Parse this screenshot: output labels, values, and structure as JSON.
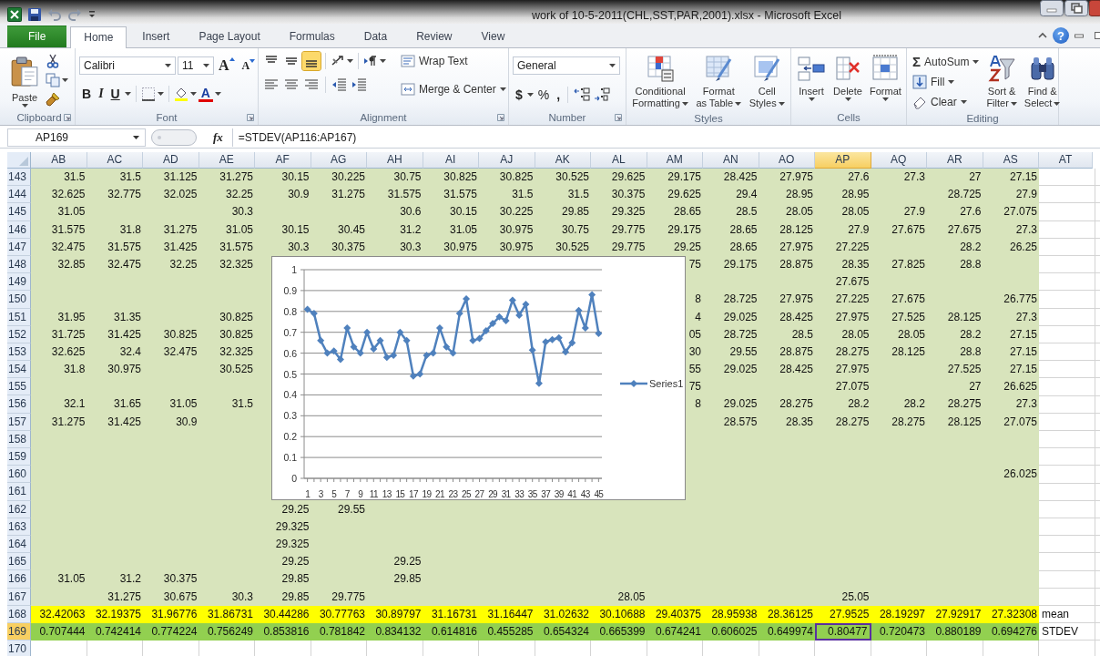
{
  "window": {
    "title": "work of 10-5-2011(CHL,SST,PAR,2001).xlsx  -  Microsoft Excel"
  },
  "tabs": [
    {
      "label": "File",
      "kind": "file",
      "selected": false
    },
    {
      "label": "Home",
      "kind": "tab",
      "selected": true
    },
    {
      "label": "Insert",
      "kind": "tab",
      "selected": false
    },
    {
      "label": "Page Layout",
      "kind": "tab",
      "selected": false
    },
    {
      "label": "Formulas",
      "kind": "tab",
      "selected": false
    },
    {
      "label": "Data",
      "kind": "tab",
      "selected": false
    },
    {
      "label": "Review",
      "kind": "tab",
      "selected": false
    },
    {
      "label": "View",
      "kind": "tab",
      "selected": false
    }
  ],
  "help": "?",
  "ribbon": {
    "clipboard": {
      "label": "Clipboard",
      "paste": "Paste"
    },
    "font": {
      "label": "Font",
      "family": "Calibri",
      "size": "11",
      "grow": "A",
      "shrink": "A",
      "bold": "B",
      "italic": "I",
      "underline": "U",
      "color_letter": "A"
    },
    "alignment": {
      "label": "Alignment",
      "vertical": [
        {
          "selected": false
        },
        {
          "selected": false
        },
        {
          "selected": true
        }
      ],
      "wrap": "Wrap Text",
      "merge": "Merge & Center"
    },
    "number": {
      "label": "Number",
      "format": "General",
      "currency": "$",
      "percent": "%",
      "comma": ","
    },
    "styles": {
      "label": "Styles",
      "buttons": [
        {
          "lines": [
            "Conditional",
            "Formatting"
          ]
        },
        {
          "lines": [
            "Format",
            "as Table"
          ]
        },
        {
          "lines": [
            "Cell",
            "Styles"
          ]
        }
      ]
    },
    "cells": {
      "label": "Cells",
      "buttons": [
        "Insert",
        "Delete",
        "Format"
      ]
    },
    "editing": {
      "label": "Editing",
      "sigma": "Σ",
      "autosum": "AutoSum",
      "fill": "Fill",
      "clear": "Clear",
      "sort": [
        "Sort &",
        "Filter"
      ],
      "find": [
        "Find &",
        "Select"
      ]
    }
  },
  "formula_bar": {
    "name_box": "AP169",
    "fx": "fx",
    "formula": "=STDEV(AP116:AP167)"
  },
  "sheet": {
    "columns": [
      {
        "label": "AB",
        "selected": false
      },
      {
        "label": "AC",
        "selected": false
      },
      {
        "label": "AD",
        "selected": false
      },
      {
        "label": "AE",
        "selected": false
      },
      {
        "label": "AF",
        "selected": false
      },
      {
        "label": "AG",
        "selected": false
      },
      {
        "label": "AH",
        "selected": false
      },
      {
        "label": "AI",
        "selected": false
      },
      {
        "label": "AJ",
        "selected": false
      },
      {
        "label": "AK",
        "selected": false
      },
      {
        "label": "AL",
        "selected": false
      },
      {
        "label": "AM",
        "selected": false
      },
      {
        "label": "AN",
        "selected": false
      },
      {
        "label": "AO",
        "selected": false
      },
      {
        "label": "AP",
        "selected": true
      },
      {
        "label": "AQ",
        "selected": false
      },
      {
        "label": "AR",
        "selected": false
      },
      {
        "label": "AS",
        "selected": false
      },
      {
        "label": "AT",
        "selected": false
      }
    ],
    "rows": [
      {
        "num": "143",
        "kind": "data",
        "selected": false,
        "cells": [
          "31.5",
          "31.5",
          "31.125",
          "31.275",
          "30.15",
          "30.225",
          "30.75",
          "30.825",
          "30.825",
          "30.525",
          "29.625",
          "29.175",
          "28.425",
          "27.975",
          "27.6",
          "27.3",
          "27",
          "27.15",
          null
        ]
      },
      {
        "num": "144",
        "kind": "data",
        "selected": false,
        "cells": [
          "32.625",
          "32.775",
          "32.025",
          "32.25",
          "30.9",
          "31.275",
          "31.575",
          "31.575",
          "31.5",
          "31.5",
          "30.375",
          "29.625",
          "29.4",
          "28.95",
          "28.95",
          null,
          "28.725",
          "27.9",
          null
        ]
      },
      {
        "num": "145",
        "kind": "data",
        "selected": false,
        "cells": [
          "31.05",
          null,
          null,
          "30.3",
          null,
          null,
          "30.6",
          "30.15",
          "30.225",
          "29.85",
          "29.325",
          "28.65",
          "28.5",
          "28.05",
          "28.05",
          "27.9",
          "27.6",
          "27.075",
          null
        ]
      },
      {
        "num": "146",
        "kind": "data",
        "selected": false,
        "cells": [
          "31.575",
          "31.8",
          "31.275",
          "31.05",
          "30.15",
          "30.45",
          "31.2",
          "31.05",
          "30.975",
          "30.75",
          "29.775",
          "29.175",
          "28.65",
          "28.125",
          "27.9",
          "27.675",
          "27.675",
          "27.3",
          null
        ]
      },
      {
        "num": "147",
        "kind": "data",
        "selected": false,
        "cells": [
          "32.475",
          "31.575",
          "31.425",
          "31.575",
          "30.3",
          "30.375",
          "30.3",
          "30.975",
          "30.975",
          "30.525",
          "29.775",
          "29.25",
          "28.65",
          "27.975",
          "27.225",
          null,
          "28.2",
          "26.25",
          null
        ]
      },
      {
        "num": "148",
        "kind": "data",
        "selected": false,
        "cells": [
          "32.85",
          "32.475",
          "32.25",
          "32.325",
          null,
          null,
          null,
          null,
          null,
          null,
          null,
          "75",
          "29.175",
          "28.875",
          "28.35",
          "27.825",
          "28.8",
          null,
          null
        ]
      },
      {
        "num": "149",
        "kind": "data",
        "selected": false,
        "cells": [
          null,
          null,
          null,
          null,
          null,
          null,
          null,
          null,
          null,
          null,
          null,
          null,
          null,
          null,
          "27.675",
          null,
          null,
          null,
          null
        ]
      },
      {
        "num": "150",
        "kind": "data",
        "selected": false,
        "cells": [
          null,
          null,
          null,
          null,
          null,
          null,
          null,
          null,
          null,
          null,
          null,
          "8",
          "28.725",
          "27.975",
          "27.225",
          "27.675",
          null,
          "26.775",
          null
        ]
      },
      {
        "num": "151",
        "kind": "data",
        "selected": false,
        "cells": [
          "31.95",
          "31.35",
          null,
          "30.825",
          null,
          null,
          null,
          null,
          null,
          null,
          null,
          "4",
          "29.025",
          "28.425",
          "27.975",
          "27.525",
          "28.125",
          "27.3",
          null
        ]
      },
      {
        "num": "152",
        "kind": "data",
        "selected": false,
        "cells": [
          "31.725",
          "31.425",
          "30.825",
          "30.825",
          null,
          null,
          null,
          null,
          null,
          null,
          null,
          "05",
          "28.725",
          "28.5",
          "28.05",
          "28.05",
          "28.2",
          "27.15",
          null
        ]
      },
      {
        "num": "153",
        "kind": "data",
        "selected": false,
        "cells": [
          "32.625",
          "32.4",
          "32.475",
          "32.325",
          null,
          null,
          null,
          null,
          null,
          null,
          null,
          "30",
          "29.55",
          "28.875",
          "28.275",
          "28.125",
          "28.8",
          "27.15",
          null
        ]
      },
      {
        "num": "154",
        "kind": "data",
        "selected": false,
        "cells": [
          "31.8",
          "30.975",
          null,
          "30.525",
          null,
          null,
          null,
          null,
          null,
          null,
          null,
          "55",
          "29.025",
          "28.425",
          "27.975",
          null,
          "27.525",
          "27.15",
          null
        ]
      },
      {
        "num": "155",
        "kind": "data",
        "selected": false,
        "cells": [
          null,
          null,
          null,
          null,
          null,
          null,
          null,
          null,
          null,
          null,
          null,
          "75",
          null,
          null,
          "27.075",
          null,
          "27",
          "26.625",
          null
        ]
      },
      {
        "num": "156",
        "kind": "data",
        "selected": false,
        "cells": [
          "32.1",
          "31.65",
          "31.05",
          "31.5",
          null,
          null,
          null,
          null,
          null,
          null,
          null,
          "8",
          "29.025",
          "28.275",
          "28.2",
          "28.2",
          "28.275",
          "27.3",
          null
        ]
      },
      {
        "num": "157",
        "kind": "data",
        "selected": false,
        "cells": [
          "31.275",
          "31.425",
          "30.9",
          null,
          null,
          null,
          null,
          null,
          null,
          null,
          null,
          null,
          "28.575",
          "28.35",
          "28.275",
          "28.275",
          "28.125",
          "27.075",
          null
        ]
      },
      {
        "num": "158",
        "kind": "data",
        "selected": false,
        "cells": [
          null,
          null,
          null,
          null,
          null,
          null,
          null,
          null,
          null,
          null,
          null,
          null,
          null,
          null,
          null,
          null,
          null,
          null,
          null
        ]
      },
      {
        "num": "159",
        "kind": "data",
        "selected": false,
        "cells": [
          null,
          null,
          null,
          null,
          null,
          null,
          null,
          null,
          null,
          null,
          null,
          null,
          null,
          null,
          null,
          null,
          null,
          null,
          null
        ]
      },
      {
        "num": "160",
        "kind": "data",
        "selected": false,
        "cells": [
          null,
          null,
          null,
          null,
          null,
          null,
          null,
          null,
          null,
          null,
          null,
          null,
          null,
          null,
          null,
          null,
          null,
          "26.025",
          null
        ]
      },
      {
        "num": "161",
        "kind": "data",
        "selected": false,
        "cells": [
          null,
          null,
          null,
          null,
          null,
          null,
          null,
          null,
          null,
          null,
          null,
          null,
          null,
          null,
          null,
          null,
          null,
          null,
          null
        ]
      },
      {
        "num": "162",
        "kind": "data",
        "selected": false,
        "cells": [
          null,
          null,
          null,
          null,
          "29.25",
          "29.55",
          null,
          null,
          null,
          null,
          null,
          null,
          null,
          null,
          null,
          null,
          null,
          null,
          null
        ]
      },
      {
        "num": "163",
        "kind": "data",
        "selected": false,
        "cells": [
          null,
          null,
          null,
          null,
          "29.325",
          null,
          null,
          null,
          null,
          null,
          null,
          null,
          null,
          null,
          null,
          null,
          null,
          null,
          null
        ]
      },
      {
        "num": "164",
        "kind": "data",
        "selected": false,
        "cells": [
          null,
          null,
          null,
          null,
          "29.325",
          null,
          null,
          null,
          null,
          null,
          null,
          null,
          null,
          null,
          null,
          null,
          null,
          null,
          null
        ]
      },
      {
        "num": "165",
        "kind": "data",
        "selected": false,
        "cells": [
          null,
          null,
          null,
          null,
          "29.25",
          null,
          "29.25",
          null,
          null,
          null,
          null,
          null,
          null,
          null,
          null,
          null,
          null,
          null,
          null
        ]
      },
      {
        "num": "166",
        "kind": "data",
        "selected": false,
        "cells": [
          "31.05",
          "31.2",
          "30.375",
          null,
          "29.85",
          null,
          "29.85",
          null,
          null,
          null,
          null,
          null,
          null,
          null,
          null,
          null,
          null,
          null,
          null
        ]
      },
      {
        "num": "167",
        "kind": "data",
        "selected": false,
        "cells": [
          null,
          "31.275",
          "30.675",
          "30.3",
          "29.85",
          "29.775",
          null,
          null,
          null,
          null,
          "28.05",
          null,
          null,
          null,
          "25.05",
          null,
          null,
          null,
          null
        ]
      },
      {
        "num": "168",
        "kind": "mean",
        "selected": false,
        "cells": [
          "32.42063",
          "32.19375",
          "31.96776",
          "31.86731",
          "30.44286",
          "30.77763",
          "30.89797",
          "31.16731",
          "31.16447",
          "31.02632",
          "30.10688",
          "29.40375",
          "28.95938",
          "28.36125",
          "27.9525",
          "28.19297",
          "27.92917",
          "27.32308",
          "mean"
        ]
      },
      {
        "num": "169",
        "kind": "stdev",
        "selected": true,
        "cells": [
          "0.707444",
          "0.742414",
          "0.774224",
          "0.756249",
          "0.853816",
          "0.781842",
          "0.834132",
          "0.614816",
          "0.455285",
          "0.654324",
          "0.665399",
          "0.674241",
          "0.606025",
          "0.649974",
          "0.80477",
          "0.720473",
          "0.880189",
          "0.694276",
          "STDEV"
        ]
      },
      {
        "num": "170",
        "kind": "empty",
        "selected": false,
        "cells": [
          null,
          null,
          null,
          null,
          null,
          null,
          null,
          null,
          null,
          null,
          null,
          null,
          null,
          null,
          null,
          null,
          null,
          null,
          null
        ]
      }
    ],
    "chart": {
      "chart_data": {
        "type": "line",
        "x": [
          1,
          2,
          3,
          4,
          5,
          6,
          7,
          8,
          9,
          10,
          11,
          12,
          13,
          14,
          15,
          16,
          17,
          18,
          19,
          20,
          21,
          22,
          23,
          24,
          25,
          26,
          27,
          28,
          29,
          30,
          31,
          32,
          33,
          34,
          35,
          36,
          37,
          38,
          39,
          40,
          41,
          42,
          43,
          44,
          45
        ],
        "series": [
          {
            "name": "Series1",
            "color": "#4f81bd",
            "marker": "diamond",
            "values": [
              0.81,
              0.79,
              0.66,
              0.6,
              0.61,
              0.57,
              0.72,
              0.63,
              0.6,
              0.7,
              0.62,
              0.66,
              0.58,
              0.59,
              0.7,
              0.66,
              0.49,
              0.5,
              0.59,
              0.6,
              0.72,
              0.63,
              0.6,
              0.79,
              0.86,
              0.66,
              0.67,
              0.707,
              0.742,
              0.774,
              0.756,
              0.854,
              0.782,
              0.834,
              0.615,
              0.455,
              0.654,
              0.665,
              0.674,
              0.606,
              0.65,
              0.805,
              0.72,
              0.88,
              0.694
            ]
          }
        ],
        "xlim": [
          0.5,
          45.5
        ],
        "grid": true,
        "ylim": [
          0,
          1
        ],
        "yticks": [
          0,
          0.1,
          0.2,
          0.3,
          0.4,
          0.5,
          0.6,
          0.7,
          0.8,
          0.9,
          1
        ],
        "xticks": [
          1,
          3,
          5,
          7,
          9,
          11,
          13,
          15,
          17,
          19,
          21,
          23,
          25,
          27,
          29,
          31,
          33,
          35,
          37,
          39,
          41,
          43,
          45
        ]
      }
    }
  }
}
